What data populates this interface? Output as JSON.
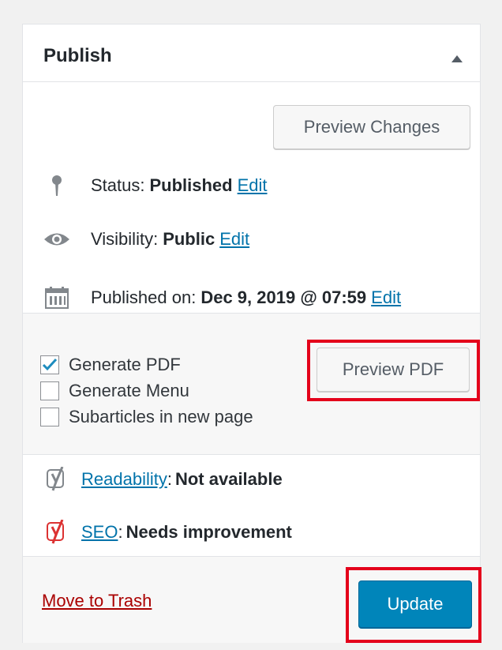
{
  "panel": {
    "title": "Publish",
    "toggle_icon": "triangle-up-icon"
  },
  "actions": {
    "preview_changes": "Preview Changes"
  },
  "status": {
    "icon": "pin-icon",
    "label": "Status:",
    "value": "Published",
    "edit": "Edit"
  },
  "visibility": {
    "icon": "eye-icon",
    "label": "Visibility:",
    "value": "Public",
    "edit": "Edit"
  },
  "published": {
    "icon": "calendar-icon",
    "label": "Published on:",
    "value": "Dec 9, 2019 @ 07:59",
    "edit": "Edit"
  },
  "pdf": {
    "options": [
      {
        "label": "Generate PDF",
        "checked": true
      },
      {
        "label": "Generate Menu",
        "checked": false
      },
      {
        "label": "Subarticles in new page",
        "checked": false
      }
    ],
    "preview_button": "Preview PDF"
  },
  "seo": {
    "readability": {
      "icon": "yoast-grey-icon",
      "link": "Readability",
      "sep": ":",
      "value": "Not available"
    },
    "seo": {
      "icon": "yoast-red-icon",
      "link": "SEO",
      "sep": ":",
      "value": "Needs improvement"
    }
  },
  "footer": {
    "trash": "Move to Trash",
    "update": "Update"
  },
  "colors": {
    "accent": "#0085ba",
    "link": "#0073aa",
    "trash": "#aa0000",
    "highlight": "#e4001b"
  }
}
